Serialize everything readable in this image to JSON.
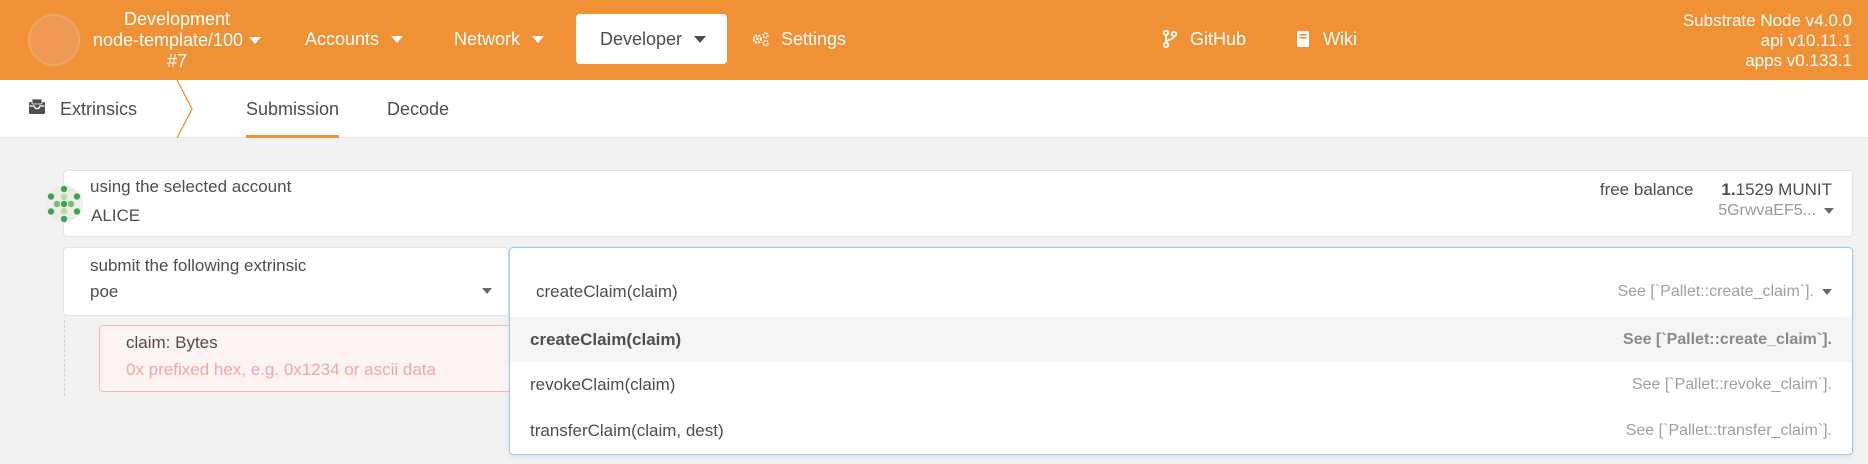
{
  "header": {
    "chain_name": "Development",
    "node_label": "node-template/100",
    "block": "#7",
    "nav": [
      {
        "label": "Accounts"
      },
      {
        "label": "Network"
      },
      {
        "label": "Developer"
      },
      {
        "label": "Settings"
      },
      {
        "label": "GitHub"
      },
      {
        "label": "Wiki"
      }
    ],
    "versions": [
      "Substrate Node v4.0.0",
      "api v10.11.1",
      "apps v0.133.1"
    ]
  },
  "tabs": {
    "section": "Extrinsics",
    "items": [
      {
        "label": "Submission"
      },
      {
        "label": "Decode"
      }
    ]
  },
  "account": {
    "label": "using the selected account",
    "name": "ALICE",
    "balance_label": "free balance",
    "balance_int": "1.",
    "balance_frac": "1529",
    "balance_unit": "MUNIT",
    "address": "5GrwvaEF5..."
  },
  "extrinsic": {
    "label": "submit the following extrinsic",
    "pallet": "poe",
    "selected_call": "createClaim(claim)",
    "selected_doc": "See [`Pallet::create_claim`].",
    "options": [
      {
        "call": "createClaim(claim)",
        "doc": "See [`Pallet::create_claim`]."
      },
      {
        "call": "revokeClaim(claim)",
        "doc": "See [`Pallet::revoke_claim`]."
      },
      {
        "call": "transferClaim(claim, dest)",
        "doc": "See [`Pallet::transfer_claim`]."
      }
    ]
  },
  "param": {
    "label": "claim: Bytes",
    "placeholder": "0x prefixed hex, e.g. 0x1234 or ascii data"
  },
  "colors": {
    "brand": "#f19135",
    "error_bg": "#fdf3f3",
    "error_border": "#f2b8b8",
    "focus_border": "#9ccbf0"
  }
}
